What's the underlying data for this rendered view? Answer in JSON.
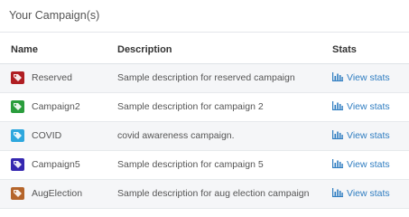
{
  "panel": {
    "title": "Your Campaign(s)"
  },
  "table": {
    "headers": {
      "name": "Name",
      "description": "Description",
      "stats": "Stats"
    },
    "rows": [
      {
        "name": "Reserved",
        "description": "Sample description for reserved campaign",
        "stats": "View stats",
        "color": "#b01e23"
      },
      {
        "name": "Campaign2",
        "description": "Sample description for campaign 2",
        "stats": "View stats",
        "color": "#2a9d3c"
      },
      {
        "name": "COVID",
        "description": "covid awareness campaign.",
        "stats": "View stats",
        "color": "#2fa8de"
      },
      {
        "name": "Campaign5",
        "description": "Sample description for campaign 5",
        "stats": "View stats",
        "color": "#3527b0"
      },
      {
        "name": "AugElection",
        "description": "Sample description for aug election campaign",
        "stats": "View stats",
        "color": "#b5652b"
      }
    ]
  },
  "colors": {
    "link": "#2f7dc1",
    "stripe": "#f5f6f8"
  },
  "icons": {
    "tag": "tag-icon",
    "stats": "bar-chart-icon"
  }
}
